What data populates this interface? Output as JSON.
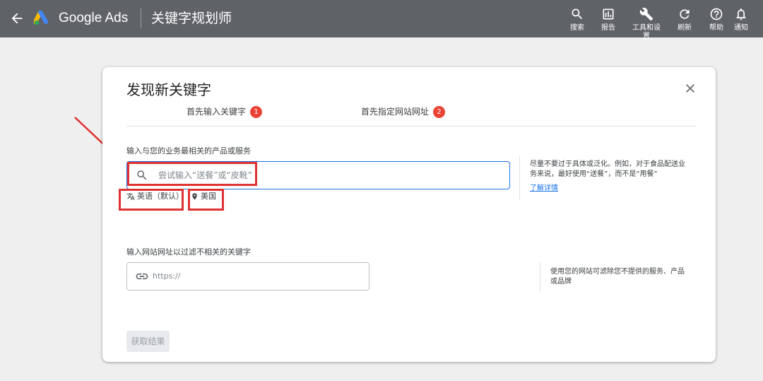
{
  "topbar": {
    "brand": "Google Ads",
    "page_title": "关键字规划师",
    "tools": [
      {
        "label": "搜索",
        "icon": "search-icon"
      },
      {
        "label": "报告",
        "icon": "report-icon"
      },
      {
        "label": "工具和设置",
        "icon": "wrench-icon"
      },
      {
        "label": "刷新",
        "icon": "refresh-icon"
      },
      {
        "label": "帮助",
        "icon": "help-icon"
      },
      {
        "label": "通知",
        "icon": "bell-icon"
      }
    ]
  },
  "card": {
    "title": "发现新关键字",
    "tabs": [
      {
        "label": "首先输入关键字",
        "badge": "1"
      },
      {
        "label": "首先指定网站网址",
        "badge": "2"
      }
    ],
    "keyword_section": {
      "label": "输入与您的业务最相关的产品或服务",
      "placeholder": "尝试输入“送餐”或“皮靴”",
      "language": "英语（默认）",
      "location": "美国",
      "help_text": "尽量不要过于具体或泛化。例如，对于食品配送业务来说，最好使用“送餐”，而不是“用餐”",
      "help_link": "了解详情"
    },
    "website_section": {
      "label": "输入网站网址以过滤不相关的关键字",
      "placeholder": "https://",
      "help_text": "使用您的网站可滤除您不提供的服务、产品或品牌"
    },
    "submit_label": "获取结果"
  },
  "colors": {
    "topbar": "#5f6368",
    "accent": "#1a73e8",
    "badge": "#ea4335",
    "annotation": "#e03232"
  }
}
